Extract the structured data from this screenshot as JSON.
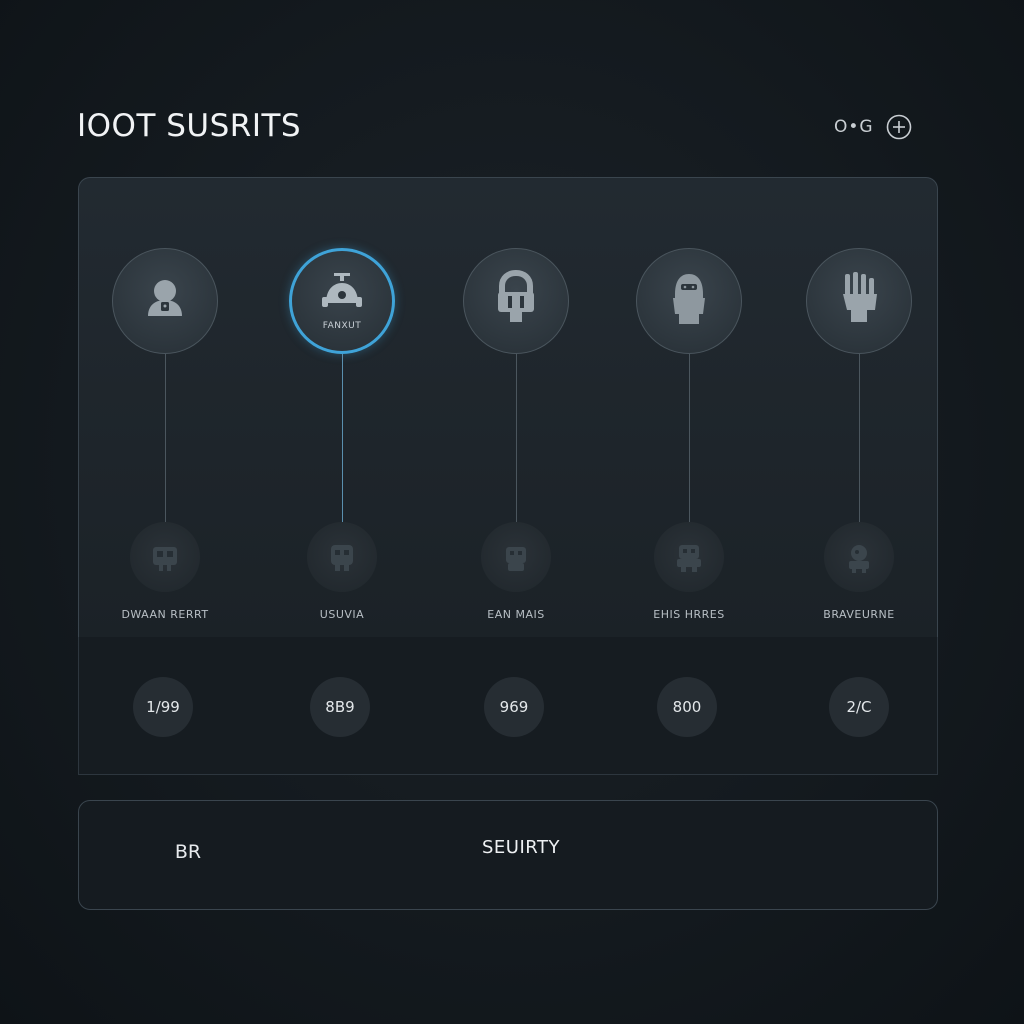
{
  "header": {
    "title": "IOOT SUSRITS",
    "control_text": "O•G",
    "control_icon": "plus-circle-icon"
  },
  "nodes": [
    {
      "top_icon": "user-lock-icon",
      "top_label": "",
      "bottom_icon": "device-icon",
      "caption": "DWAAN RERRT",
      "metric": "1/99",
      "active": false
    },
    {
      "top_icon": "robot-icon",
      "top_label": "FANXUT",
      "bottom_icon": "device-icon",
      "caption": "USUVIA",
      "metric": "8B9",
      "active": true
    },
    {
      "top_icon": "lock-icon",
      "top_label": "",
      "bottom_icon": "device-icon",
      "caption": "EAN MAIS",
      "metric": "969",
      "active": false
    },
    {
      "top_icon": "helmet-icon",
      "top_label": "",
      "bottom_icon": "device-icon",
      "caption": "EHIS HRRES",
      "metric": "800",
      "active": false
    },
    {
      "top_icon": "glove-icon",
      "top_label": "",
      "bottom_icon": "device-icon",
      "caption": "BRAVEURNE",
      "metric": "2/C",
      "active": false
    }
  ],
  "footer": {
    "icon_text": "BR",
    "label": "SEUIRTY"
  },
  "colors": {
    "accent": "#3fa3d8",
    "background": "#141a1f",
    "panel": "#222a31"
  }
}
